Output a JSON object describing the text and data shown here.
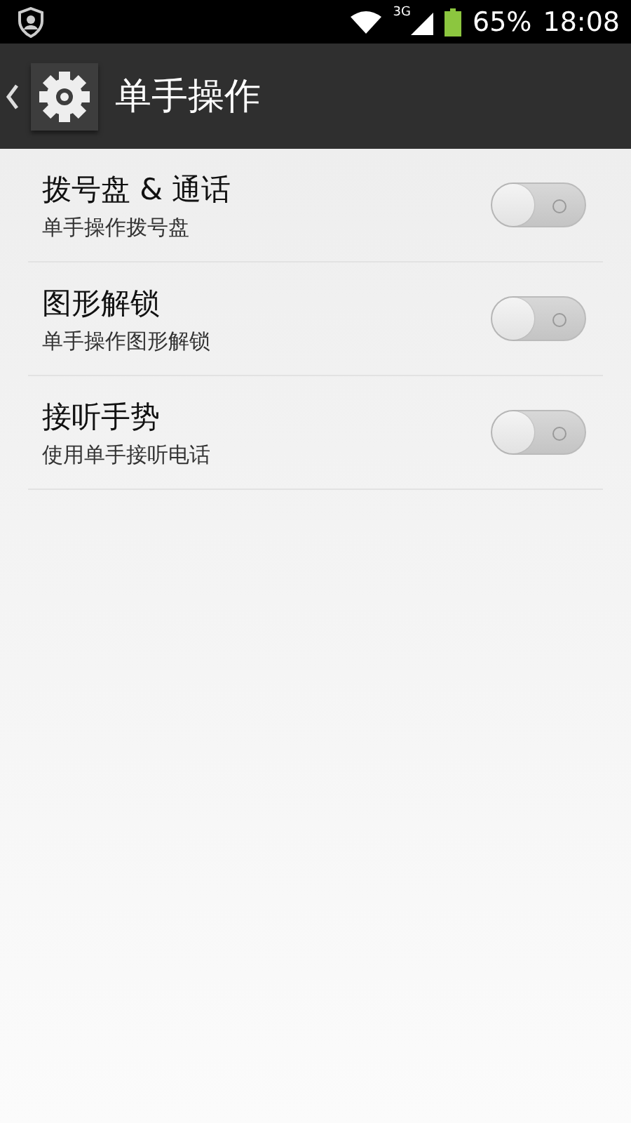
{
  "status_bar": {
    "network": "3G",
    "battery": "65%",
    "time": "18:08"
  },
  "action_bar": {
    "title": "单手操作"
  },
  "settings": [
    {
      "title": "拨号盘 & 通话",
      "subtitle": "单手操作拨号盘",
      "on": false
    },
    {
      "title": "图形解锁",
      "subtitle": "单手操作图形解锁",
      "on": false
    },
    {
      "title": "接听手势",
      "subtitle": "使用单手接听电话",
      "on": false
    }
  ]
}
